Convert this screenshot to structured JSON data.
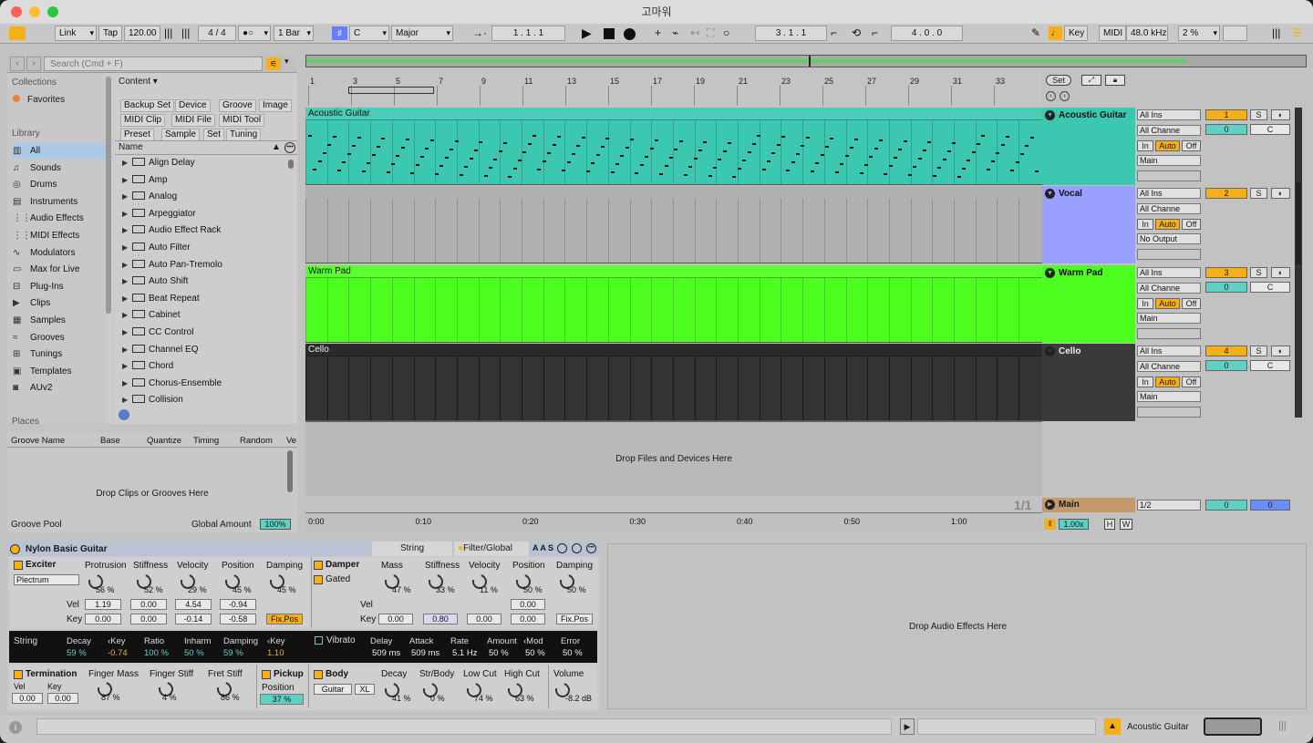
{
  "window": {
    "title": "고마워"
  },
  "toolbar": {
    "link": "Link",
    "tap": "Tap",
    "tempo": "120.00",
    "time_sig": "4 / 4",
    "metro": "1 Bar",
    "key": "C",
    "scale": "Major",
    "position": "1 .   1 .   1",
    "loop_start": "3 .   1 .   1",
    "loop_len": "4 .   0 .   0",
    "key_btn": "Key",
    "midi_btn": "MIDI",
    "sample_rate": "48.0 kHz",
    "cpu": "2 %"
  },
  "browser": {
    "search_placeholder": "Search (Cmd + F)",
    "collections_header": "Collections",
    "favorites": "Favorites",
    "library_header": "Library",
    "places_header": "Places",
    "library_items": [
      {
        "icon": "all-icon",
        "glyph": "▥",
        "label": "All"
      },
      {
        "icon": "sounds-icon",
        "glyph": "♫",
        "label": "Sounds"
      },
      {
        "icon": "drums-icon",
        "glyph": "◎",
        "label": "Drums"
      },
      {
        "icon": "instruments-icon",
        "glyph": "▤",
        "label": "Instruments"
      },
      {
        "icon": "audio-effects-icon",
        "glyph": "⋮⋮",
        "label": "Audio Effects"
      },
      {
        "icon": "midi-effects-icon",
        "glyph": "⋮⋮",
        "label": "MIDI Effects"
      },
      {
        "icon": "modulators-icon",
        "glyph": "∿",
        "label": "Modulators"
      },
      {
        "icon": "max-for-live-icon",
        "glyph": "▭",
        "label": "Max for Live"
      },
      {
        "icon": "plug-ins-icon",
        "glyph": "⊟",
        "label": "Plug-Ins"
      },
      {
        "icon": "clips-icon",
        "glyph": "▶",
        "label": "Clips"
      },
      {
        "icon": "samples-icon",
        "glyph": "▦",
        "label": "Samples"
      },
      {
        "icon": "grooves-icon",
        "glyph": "≈",
        "label": "Grooves"
      },
      {
        "icon": "tunings-icon",
        "glyph": "⊞",
        "label": "Tunings"
      },
      {
        "icon": "templates-icon",
        "glyph": "▣",
        "label": "Templates"
      },
      {
        "icon": "auv2-icon",
        "glyph": "◙",
        "label": "AUv2"
      }
    ],
    "content_label": "Content ▾",
    "filters": [
      "Backup Set",
      "Device",
      "Groove",
      "Image",
      "MIDI Clip",
      "MIDI File",
      "MIDI Tool",
      "Preset",
      "Sample",
      "Set",
      "Tuning"
    ],
    "name_header": "Name",
    "items": [
      "Align Delay",
      "Amp",
      "Analog",
      "Arpeggiator",
      "Audio Effect Rack",
      "Auto Filter",
      "Auto Pan-Tremolo",
      "Auto Shift",
      "Beat Repeat",
      "Cabinet",
      "CC Control",
      "Channel EQ",
      "Chord",
      "Chorus-Ensemble",
      "Collision"
    ]
  },
  "groove": {
    "headers": [
      "Groove Name",
      "Base",
      "Quantize",
      "Timing",
      "Random",
      "Ve"
    ],
    "drop": "Drop Clips or Grooves Here",
    "pool": "Groove Pool",
    "global_label": "Global Amount",
    "global_value": "100%"
  },
  "arrangement": {
    "ruler": [
      "1",
      "3",
      "5",
      "7",
      "9",
      "11",
      "13",
      "15",
      "17",
      "19",
      "21",
      "23",
      "25",
      "27",
      "29",
      "31",
      "33"
    ],
    "set_btn": "Set",
    "time": [
      "0:00",
      "0:10",
      "0:20",
      "0:30",
      "0:40",
      "0:50",
      "1:00"
    ],
    "drop": "Drop Files and Devices Here",
    "page": "1/1",
    "zoom": "1.00x",
    "h": "H",
    "w": "W"
  },
  "tracks": [
    {
      "clip": "Acoustic Guitar",
      "name": "Acoustic Guitar",
      "color": "#3cc8b0",
      "head": "#3cc8b0",
      "input": "All Ins",
      "channel": "All Channe",
      "output": "Main",
      "num": "1",
      "vol": "0",
      "pan": "C"
    },
    {
      "clip": "",
      "name": "Vocal",
      "color": "#b0b0b0",
      "head": "#9aa0ff",
      "input": "All Ins",
      "channel": "All Channe",
      "output": "No Output",
      "num": "2",
      "vol": "",
      "pan": ""
    },
    {
      "clip": "Warm Pad",
      "name": "Warm Pad",
      "color": "#4cff1e",
      "head": "#4cff1e",
      "input": "All Ins",
      "channel": "All Channe",
      "output": "Main",
      "num": "3",
      "vol": "0",
      "pan": "C"
    },
    {
      "clip": "Cello",
      "name": "Cello",
      "color": "#333333",
      "head": "#3a3a3a",
      "input": "All Ins",
      "channel": "All Channe",
      "output": "Main",
      "num": "4",
      "vol": "0",
      "pan": "C"
    }
  ],
  "monitor": {
    "in": "In",
    "auto": "Auto",
    "off": "Off",
    "s": "S"
  },
  "main_track": {
    "name": "Main",
    "sig": "1/2",
    "vol": "0",
    "vol2": "0"
  },
  "device": {
    "title": "Nylon Basic Guitar",
    "tab_string": "String",
    "tab_filter": "Filter/Global",
    "exciter": "Exciter",
    "exciter_type": "Plectrum",
    "ex_params": [
      {
        "l": "Protrusion",
        "v": "56 %"
      },
      {
        "l": "Stiffness",
        "v": "52 %"
      },
      {
        "l": "Velocity",
        "v": "29 %"
      },
      {
        "l": "Position",
        "v": "45 %"
      },
      {
        "l": "Damping",
        "v": "45 %"
      }
    ],
    "vel_label": "Vel",
    "key_label": "Key",
    "ex_vel": [
      "1.19",
      "0.00",
      "4.54",
      "-0.94"
    ],
    "ex_key": [
      "0.00",
      "0.00",
      "-0.14",
      "-0.58"
    ],
    "fixpos": "Fix.Pos",
    "damper": "Damper",
    "gated": "Gated",
    "dm_params": [
      {
        "l": "Mass",
        "v": "47 %"
      },
      {
        "l": "Stiffness",
        "v": "33 %"
      },
      {
        "l": "Velocity",
        "v": "11 %"
      },
      {
        "l": "Position",
        "v": "50 %"
      },
      {
        "l": "Damping",
        "v": "50 %"
      }
    ],
    "dm_vel": [
      "0.00"
    ],
    "dm_key": [
      "0.00",
      "0.80",
      "0.00",
      "0.00"
    ],
    "string": {
      "label": "String",
      "params": [
        {
          "l": "Decay",
          "v": "59 %"
        },
        {
          "l": "‹Key",
          "v": "-0.74"
        },
        {
          "l": "Ratio",
          "v": "100 %"
        },
        {
          "l": "Inharm",
          "v": "50 %"
        },
        {
          "l": "Damping",
          "v": "59 %"
        },
        {
          "l": "‹Key",
          "v": "1.10"
        }
      ]
    },
    "vibrato": {
      "label": "Vibrato",
      "params": [
        {
          "l": "Delay",
          "v": "509 ms"
        },
        {
          "l": "Attack",
          "v": "509 ms"
        },
        {
          "l": "Rate",
          "v": "5.1 Hz"
        },
        {
          "l": "Amount",
          "v": "50 %"
        },
        {
          "l": "‹Mod",
          "v": "50 %"
        },
        {
          "l": "Error",
          "v": "50 %"
        }
      ]
    },
    "termination": "Termination",
    "term_vel": "0.00",
    "term_key": "0.00",
    "term_params": [
      {
        "l": "Finger Mass",
        "v": "87 %"
      },
      {
        "l": "Finger Stiff",
        "v": "4 %"
      },
      {
        "l": "Fret Stiff",
        "v": "86 %"
      }
    ],
    "pickup": "Pickup",
    "pickup_pos_label": "Position",
    "pickup_pos": "37 %",
    "body": "Body",
    "body_type": "Guitar",
    "body_size": "XL",
    "body_params": [
      {
        "l": "Decay",
        "v": "41 %"
      },
      {
        "l": "Str/Body",
        "v": "0 %"
      },
      {
        "l": "Low Cut",
        "v": "74 %"
      },
      {
        "l": "High Cut",
        "v": "63 %"
      }
    ],
    "volume_label": "Volume",
    "volume": "-8.2 dB"
  },
  "fx_drop": "Drop Audio Effects Here",
  "status": {
    "track": "Acoustic Guitar"
  }
}
